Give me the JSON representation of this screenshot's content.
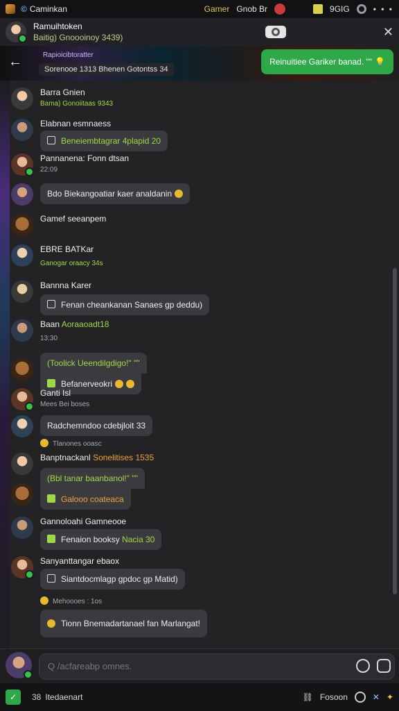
{
  "topbar": {
    "title": "Caminkan",
    "game_label": "Gamer",
    "chat_label": "Gnob Br",
    "score": "9GIG",
    "menu": "• • •"
  },
  "header": {
    "name": "Ramuihtoken",
    "sub": "Baitig) Gnoooinoy 3439)",
    "close": "✕"
  },
  "banner": {
    "label_top": "Rapioicibtoratter",
    "pill": "Sorenooe  1313  Bhenen  Gotontss  34",
    "cta": "Reinuitiee Gariker banad. \"\""
  },
  "messages": [
    {
      "avatar": "av-a",
      "name": "Barra Gnien",
      "meta": "Bama) Gonoiitaas 9343",
      "text": ""
    },
    {
      "avatar": "av-b",
      "name": "Elabnan esmnaess",
      "meta": "",
      "text": "Beneiembtagrar 4plapid 20",
      "variant": "icon"
    },
    {
      "avatar": "av-c",
      "name": "Pannanena: Fonn dtsan",
      "meta": "22:09",
      "text": ""
    },
    {
      "avatar": "av-d",
      "name": "",
      "meta": "",
      "text": "Bdo Biekangoatiar kaer analdanin"
    },
    {
      "avatar": "av-e",
      "name": "Gamef seeanpem",
      "meta": "",
      "text": ""
    },
    {
      "avatar": "av-f",
      "name": "EBRE BATKar",
      "meta": "Ganogar oraacy 34s",
      "text": ""
    },
    {
      "avatar": "av-a",
      "name": "Bannna Karer",
      "meta": "",
      "text": "Fenan cheankanan Sanaes gp deddu)",
      "variant": "icon"
    },
    {
      "avatar": "av-b",
      "name": "Baan",
      "meta": "13:30",
      "tag": "Aoraaoadt18",
      "text": ""
    },
    {
      "avatar": "av-e",
      "name": "",
      "meta": "",
      "text": "(Toolick Ueendilgdigo!\" \"\"",
      "green": true
    },
    {
      "avatar": "av-e",
      "name": "",
      "meta": "",
      "text": "Befanerveokri",
      "variant": "gbox"
    },
    {
      "avatar": "av-c",
      "name": "Ganti Isl",
      "meta": "Mees Bei boses",
      "text": ""
    },
    {
      "avatar": "av-f",
      "name": "",
      "meta": "",
      "text": "Radchemndoo cdebjloit 33"
    },
    {
      "avatar": "av-d",
      "name": "",
      "meta": "Tlanones  ooasc",
      "text": ""
    },
    {
      "avatar": "av-a",
      "name": "Banptnackanl",
      "meta": "",
      "tag": "Sonelitises  1535",
      "text": ""
    },
    {
      "avatar": "av-e",
      "name": "",
      "meta": "",
      "text": "(Bbl tanar baanbanol!\" \"\"",
      "green": true
    },
    {
      "avatar": "av-e",
      "name": "",
      "meta": "",
      "text": "Galooo coateaca",
      "variant": "orange"
    },
    {
      "avatar": "av-b",
      "name": "Gannoloahi Gamneooe",
      "meta": "",
      "text": "Fenaion booksy",
      "tag2": "Nacia 30",
      "variant": "gbox"
    },
    {
      "avatar": "av-c",
      "name": "Sanyanttangar ebaox",
      "meta": "",
      "text": "Siantdocmlagp gpdoc gp Matid)",
      "variant": "icon"
    },
    {
      "avatar": "av-d",
      "name": "",
      "meta": "Mehoooes : 1os",
      "text": ""
    },
    {
      "avatar": "av-f",
      "name": "",
      "meta": "",
      "text": "Tionn Bnemadartanael fan Marlangat!"
    }
  ],
  "composer": {
    "placeholder": "Q /acfareabp omnes."
  },
  "bottombar": {
    "count": "38",
    "label": "Itedaenart",
    "right_label": "Fosoon"
  }
}
